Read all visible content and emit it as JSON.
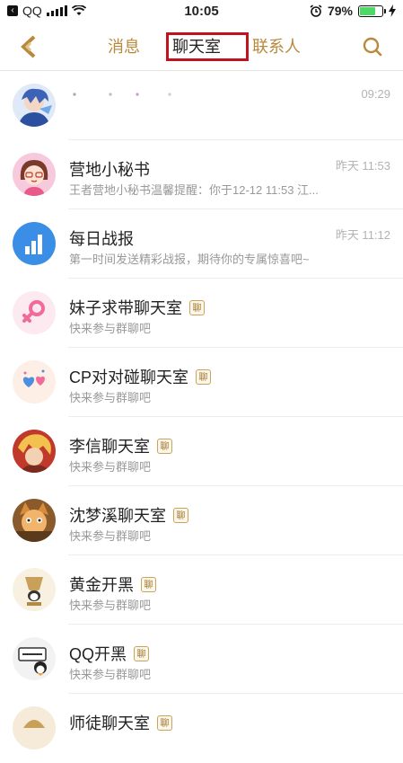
{
  "status_bar": {
    "carrier": "QQ",
    "time": "10:05",
    "battery_percent": "79%",
    "battery_level": 0.79
  },
  "nav": {
    "tabs": [
      {
        "label": "消息"
      },
      {
        "label": "聊天室"
      },
      {
        "label": "联系人"
      }
    ],
    "active_tab": "聊天室",
    "accent_color": "#b8893c",
    "highlight_color": "#c1121f"
  },
  "list": {
    "rows": [
      {
        "title": "",
        "subtitle": "",
        "time": "09:29",
        "avatar": "blue-anime-avatar",
        "badge": false
      },
      {
        "title": "营地小秘书",
        "subtitle": "王者营地小秘书温馨提醒：你于12-12 11:53 江...",
        "time": "昨天 11:53",
        "avatar": "girl-avatar",
        "badge": false
      },
      {
        "title": "每日战报",
        "subtitle": "第一时间发送精彩战报，期待你的专属惊喜吧~",
        "time": "昨天 11:12",
        "avatar": "bar-chart-avatar",
        "badge": false
      },
      {
        "title": "妹子求带聊天室",
        "subtitle": "快来参与群聊吧",
        "time": "",
        "avatar": "female-symbol-avatar",
        "badge": true
      },
      {
        "title": "CP对对碰聊天室",
        "subtitle": "快来参与群聊吧",
        "time": "",
        "avatar": "hearts-avatar",
        "badge": true
      },
      {
        "title": "李信聊天室",
        "subtitle": "快来参与群聊吧",
        "time": "",
        "avatar": "hero-avatar",
        "badge": true
      },
      {
        "title": "沈梦溪聊天室",
        "subtitle": "快来参与群聊吧",
        "time": "",
        "avatar": "cat-hero-avatar",
        "badge": true
      },
      {
        "title": "黄金开黑",
        "subtitle": "快来参与群聊吧",
        "time": "",
        "avatar": "gold-trophy-avatar",
        "badge": true
      },
      {
        "title": "QQ开黑",
        "subtitle": "快来参与群聊吧",
        "time": "",
        "avatar": "penguin-sign-avatar",
        "badge": true
      },
      {
        "title": "师徒聊天室",
        "subtitle": "",
        "time": "",
        "avatar": "mentor-avatar",
        "badge": true
      }
    ],
    "badge_label": "聊"
  }
}
